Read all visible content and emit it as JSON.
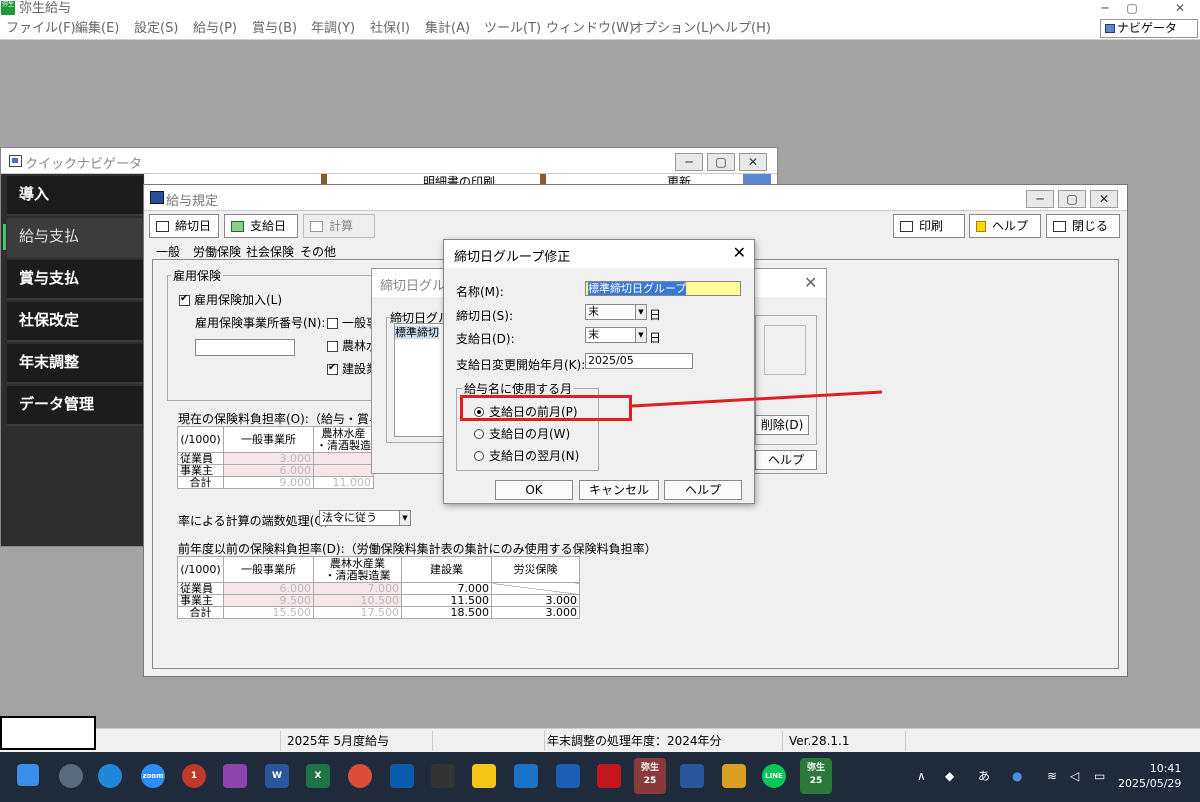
{
  "app": {
    "title": "弥生給与",
    "logo": "弥生",
    "min": "─",
    "max": "▢",
    "close": "✕"
  },
  "menu": [
    "ファイル(F)",
    "編集(E)",
    "設定(S)",
    "給与(P)",
    "賞与(B)",
    "年調(Y)",
    "社保(I)",
    "集計(A)",
    "ツール(T)",
    "ウィンドウ(W)",
    "オプション(L)",
    "ヘルプ(H)"
  ],
  "navigator_button": "ナビゲータ",
  "quick_nav": {
    "title": "クイックナビゲータ",
    "header_text": "明細書の印刷",
    "header_text2": "更新",
    "items": [
      "導入",
      "給与支払",
      "賞与支払",
      "社保改定",
      "年末調整",
      "データ管理"
    ]
  },
  "kyuyo_kitei": {
    "title": "給与規定",
    "toolbar": {
      "shimebi": "締切日",
      "shikyubi": "支給日",
      "keisan": "計算",
      "print": "印刷",
      "help": "ヘルプ",
      "close": "閉じる"
    },
    "tabs": [
      "一般",
      "労働保険",
      "社会保険",
      "その他"
    ],
    "group_koyo": "雇用保険",
    "koyo_check": "雇用保険加入(L)",
    "jigyosho_label": "雇用保険事業所番号(N):",
    "cb_ippan": "一般事",
    "cb_norin": "農林水",
    "cb_kensetsu": "建設業",
    "current_rate_label": "現在の保険料負担率(O):（給与・賞与計算",
    "cur_table": {
      "unit": "(/1000)",
      "h1": "一般事業所",
      "h2": "農林水産",
      "h2b": "・清酒製造",
      "rows": [
        {
          "label": "従業員",
          "v1": "3.000",
          "v2": ""
        },
        {
          "label": "事業主",
          "v1": "6.000",
          "v2": ""
        },
        {
          "label": "合計",
          "v1": "9.000",
          "v2": "11.000"
        }
      ]
    },
    "rounding_label": "率による計算の端数処理(Q):",
    "rounding_value": "法令に従う",
    "prev_rate_label": "前年度以前の保険料負担率(D):（労働保険料集計表の集計にのみ使用する保険料負担率）",
    "prev_table": {
      "unit": "(/1000)",
      "h1": "一般事業所",
      "h2": "農林水産業",
      "h2b": "・清酒製造業",
      "h3": "建設業",
      "h4": "労災保険",
      "rows": [
        {
          "label": "従業員",
          "v1": "6.000",
          "v2": "7.000",
          "v3": "7.000",
          "v4": ""
        },
        {
          "label": "事業主",
          "v1": "9.500",
          "v2": "10.500",
          "v3": "11.500",
          "v4": "3.000"
        },
        {
          "label": "合計",
          "v1": "15.500",
          "v2": "17.500",
          "v3": "18.500",
          "v4": "3.000"
        }
      ]
    }
  },
  "behind_dialog": {
    "title": "締切日グル",
    "group_label": "締切日グル",
    "list_item": "標準締切",
    "delete_btn": "削除(D)",
    "help_btn": "ヘルプ"
  },
  "dialog": {
    "title": "締切日グループ修正",
    "name_label": "名称(M):",
    "name_value": "標準締切日グループ",
    "shimebi_label": "締切日(S):",
    "shimebi_value": "末",
    "shikyubi_label": "支給日(D):",
    "shikyubi_value": "末",
    "day": "日",
    "start_label": "支給日変更開始年月(K):",
    "start_value": "2025/05",
    "group_label": "給与名に使用する月",
    "options": [
      "支給日の前月(P)",
      "支給日の月(W)",
      "支給日の翌月(N)"
    ],
    "ok": "OK",
    "cancel": "キャンセル",
    "help": "ヘルプ"
  },
  "annotation_color": "#e02020",
  "status": {
    "period": "2025年 5月度給与",
    "year": "年末調整の処理年度：2024年分",
    "version": "Ver.28.1.1"
  },
  "taskbar": {
    "time": "10:41",
    "date": "2025/05/29",
    "ime": "あ",
    "yayoi": "弥生",
    "yayoi25": "25",
    "zoom": "zoom",
    "line": "LINE",
    "badge": "1",
    "word": "W",
    "excel": "X"
  }
}
